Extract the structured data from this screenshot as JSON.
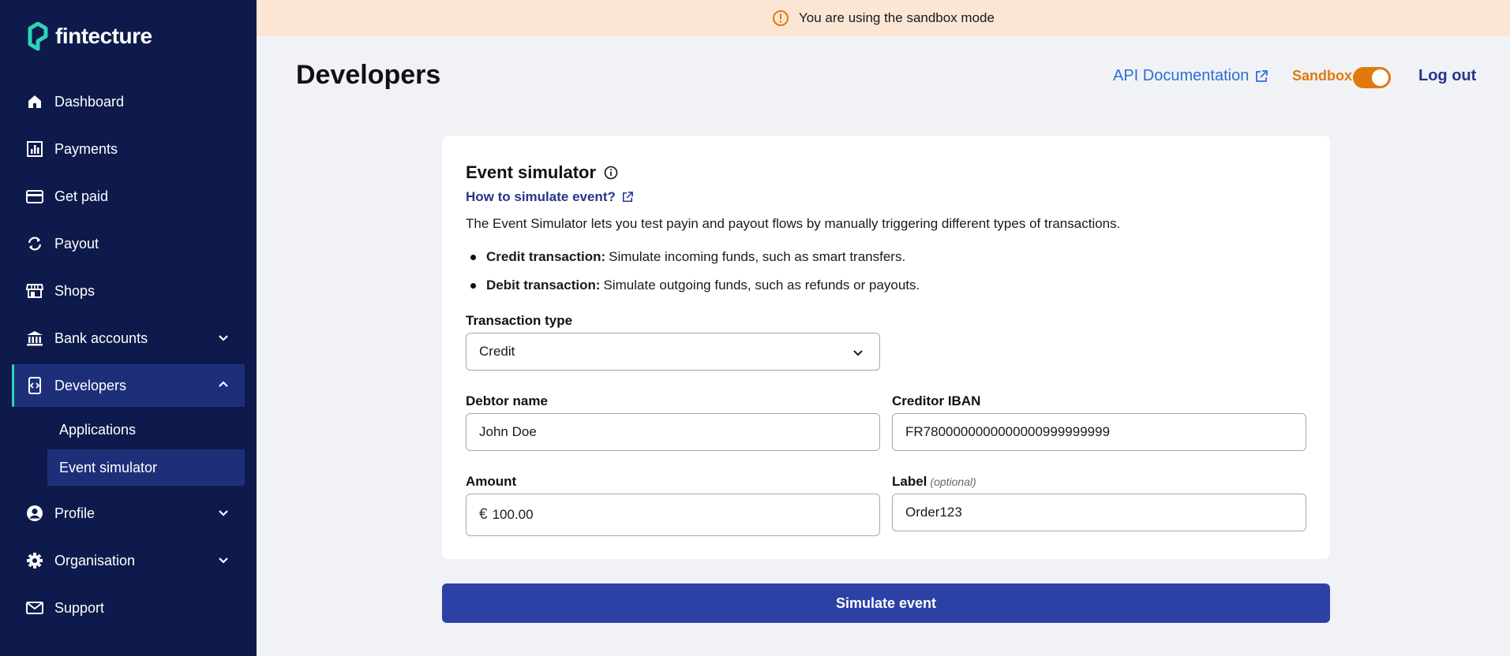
{
  "app": {
    "brand": "fintecture",
    "accent_color": "#2ed3b7",
    "sidebar_color": "#0d1a4b"
  },
  "banner": {
    "icon": "warning-circle-icon",
    "text": "You are using the sandbox mode"
  },
  "sidebar": {
    "items": [
      {
        "label": "Dashboard",
        "icon": "home-icon"
      },
      {
        "label": "Payments",
        "icon": "chart-icon"
      },
      {
        "label": "Get paid",
        "icon": "card-icon"
      },
      {
        "label": "Payout",
        "icon": "refresh-icon"
      },
      {
        "label": "Shops",
        "icon": "store-icon"
      },
      {
        "label": "Bank accounts",
        "icon": "bank-icon",
        "expanded": false
      },
      {
        "label": "Developers",
        "icon": "code-icon",
        "expanded": true,
        "active": true
      },
      {
        "label": "Profile",
        "icon": "user-icon",
        "expanded": false
      },
      {
        "label": "Organisation",
        "icon": "gear-icon",
        "expanded": false
      },
      {
        "label": "Support",
        "icon": "mail-icon"
      }
    ],
    "developers_sub": [
      {
        "label": "Applications"
      },
      {
        "label": "Event simulator",
        "selected": true
      }
    ]
  },
  "header": {
    "title": "Developers",
    "api_doc": "API Documentation",
    "sandbox_label": "Sandbox",
    "sandbox_on": true,
    "logout": "Log out"
  },
  "card": {
    "title": "Event simulator",
    "help_link": "How to simulate event?",
    "description": "The Event Simulator lets you test payin and payout flows by manually triggering different types of transactions.",
    "bullets": [
      {
        "term": "Credit transaction:",
        "text": "Simulate incoming funds, such as smart transfers."
      },
      {
        "term": "Debit transaction:",
        "text": "Simulate outgoing funds, such as refunds or payouts."
      }
    ]
  },
  "form": {
    "transaction_type": {
      "label": "Transaction type",
      "value": "Credit"
    },
    "debtor_name": {
      "label": "Debtor name",
      "value": "John Doe"
    },
    "creditor_iban": {
      "label": "Creditor IBAN",
      "value": "FR7800000000000000999999999"
    },
    "amount": {
      "label": "Amount",
      "currency": "€",
      "value": "100.00"
    },
    "label": {
      "label": "Label",
      "optional": "(optional)",
      "value": "Order123"
    }
  },
  "actions": {
    "simulate": "Simulate event"
  }
}
